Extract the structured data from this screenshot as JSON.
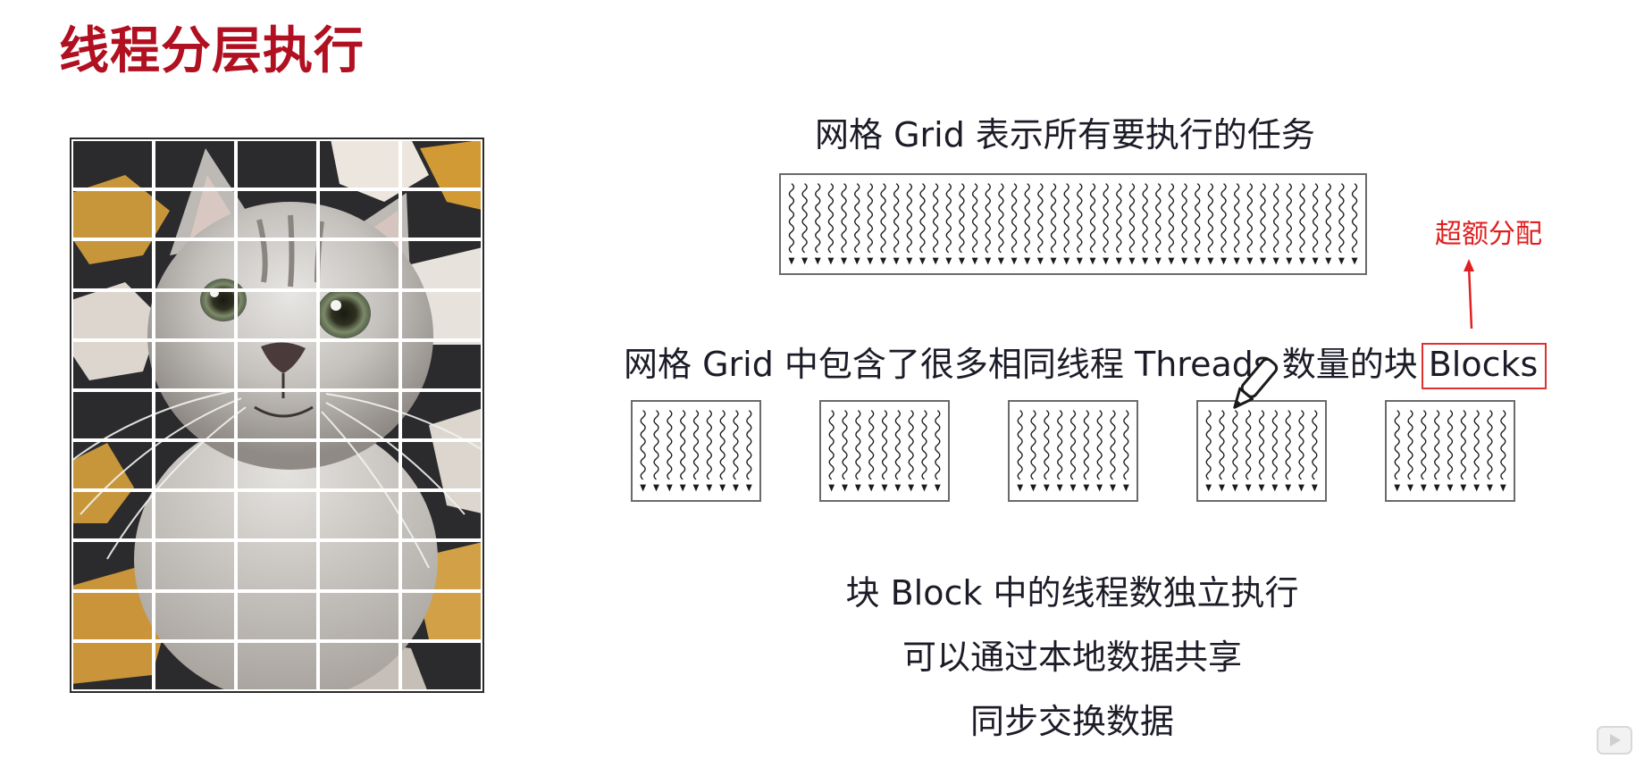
{
  "slide": {
    "title": "线程分层执行"
  },
  "left_panel": {
    "image_subject": "gray tabby cat looking up",
    "grid_overlay": {
      "columns": 5,
      "rows": 11
    }
  },
  "grid_section": {
    "caption": "网格 Grid 表示所有要执行的任务",
    "thread_icon": "wavy-arrow-icon"
  },
  "blocks_section": {
    "caption_prefix": "网格 Grid 中包含了很多相同线程 Threads 数量的块",
    "caption_highlight": "Blocks",
    "block_count": 5,
    "threads_per_block": 9,
    "grid_threads": 44
  },
  "annotation": {
    "text": "超额分配",
    "color": "#e02020"
  },
  "description": {
    "line1": "块 Block 中的线程数独立执行",
    "line2": "可以通过本地数据共享",
    "line3": "同步交换数据"
  },
  "colors": {
    "title": "#b01020",
    "text": "#1c1c28",
    "highlight_border": "#e03030"
  }
}
